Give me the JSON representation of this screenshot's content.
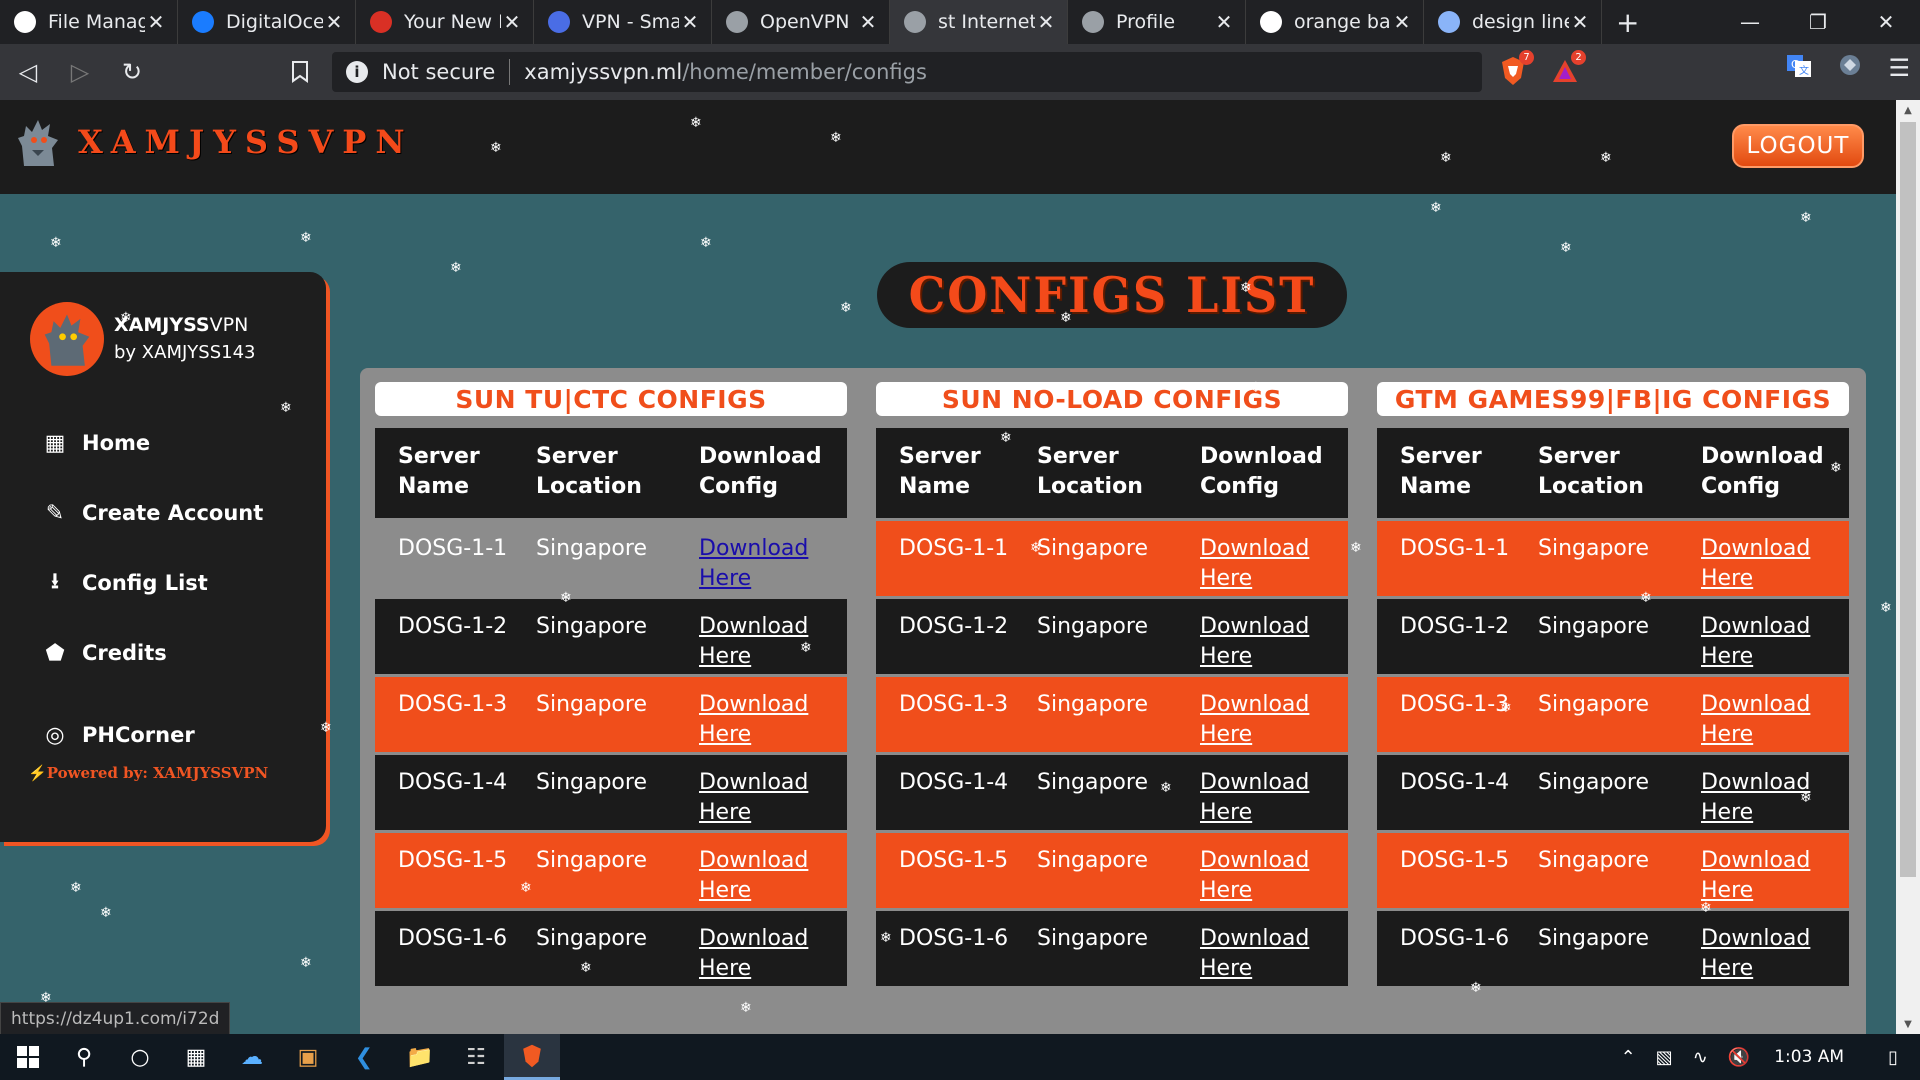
{
  "browser": {
    "tabs": [
      {
        "label": "File Manager",
        "icon": "cloud-icon",
        "color": "#ffffff",
        "active": false
      },
      {
        "label": "DigitalOcean",
        "icon": "digitalocean-icon",
        "color": "#1a7cff",
        "active": false
      },
      {
        "label": "Your New Domain",
        "icon": "gmail-icon",
        "color": "#d93025",
        "active": false
      },
      {
        "label": "VPN - Smart",
        "icon": "shield-icon",
        "color": "#4a6de5",
        "active": false
      },
      {
        "label": "OpenVPN",
        "icon": "globe-icon",
        "color": "#9aa0a6",
        "active": false
      },
      {
        "label": "st Internet Provider",
        "icon": "globe-icon",
        "color": "#9aa0a6",
        "active": true
      },
      {
        "label": "Profile",
        "icon": "globe-icon",
        "color": "#9aa0a6",
        "active": false
      },
      {
        "label": "orange bar",
        "icon": "google-icon",
        "color": "#ffffff",
        "active": false
      },
      {
        "label": "design line",
        "icon": "document-icon",
        "color": "#8ab4f8",
        "active": false
      }
    ],
    "new_tab": "+",
    "security_label": "Not secure",
    "url_host": "xamjyssvpn.ml",
    "url_path": "/home/member/configs",
    "brave_shield_count": "7",
    "brave_rewards_count": "2",
    "status_url": "https://dz4up1.com/i72d"
  },
  "site": {
    "brand": "XAMJYSSVPN",
    "logout_label": "LOGOUT",
    "page_title": "CONFIGS LIST",
    "accent": "#f04e1b"
  },
  "sidebar": {
    "profile_name_bold": "XAMJYSS",
    "profile_name_rest": "VPN",
    "profile_by": "by XAMJYSS143",
    "items": [
      {
        "label": "Home",
        "icon": "home-grid-icon"
      },
      {
        "label": "Create Account",
        "icon": "pencil-icon"
      },
      {
        "label": "Config List",
        "icon": "download-icon"
      },
      {
        "label": "Credits",
        "icon": "tags-icon"
      },
      {
        "label": "PHCorner",
        "icon": "globe-icon"
      }
    ],
    "powered": "Powered by: XAMJYSSVPN"
  },
  "tables": [
    {
      "title": "SUN TU|CTC CONFIGS",
      "headers": [
        "Server Name",
        "Server Location",
        "Download Config"
      ],
      "rows": [
        {
          "name": "DOSG-1-1",
          "location": "Singapore",
          "link": "Download Here"
        },
        {
          "name": "DOSG-1-2",
          "location": "Singapore",
          "link": "Download Here"
        },
        {
          "name": "DOSG-1-3",
          "location": "Singapore",
          "link": "Download Here"
        },
        {
          "name": "DOSG-1-4",
          "location": "Singapore",
          "link": "Download Here"
        },
        {
          "name": "DOSG-1-5",
          "location": "Singapore",
          "link": "Download Here"
        },
        {
          "name": "DOSG-1-6",
          "location": "Singapore",
          "link": "Download Here"
        }
      ]
    },
    {
      "title": "SUN NO-LOAD CONFIGS",
      "headers": [
        "Server Name",
        "Server Location",
        "Download Config"
      ],
      "rows": [
        {
          "name": "DOSG-1-1",
          "location": "Singapore",
          "link": "Download Here"
        },
        {
          "name": "DOSG-1-2",
          "location": "Singapore",
          "link": "Download Here"
        },
        {
          "name": "DOSG-1-3",
          "location": "Singapore",
          "link": "Download Here"
        },
        {
          "name": "DOSG-1-4",
          "location": "Singapore",
          "link": "Download Here"
        },
        {
          "name": "DOSG-1-5",
          "location": "Singapore",
          "link": "Download Here"
        },
        {
          "name": "DOSG-1-6",
          "location": "Singapore",
          "link": "Download Here"
        }
      ]
    },
    {
      "title": "GTM GAMES99|FB|IG CONFIGS",
      "headers": [
        "Server Name",
        "Server Location",
        "Download Config"
      ],
      "rows": [
        {
          "name": "DOSG-1-1",
          "location": "Singapore",
          "link": "Download Here"
        },
        {
          "name": "DOSG-1-2",
          "location": "Singapore",
          "link": "Download Here"
        },
        {
          "name": "DOSG-1-3",
          "location": "Singapore",
          "link": "Download Here"
        },
        {
          "name": "DOSG-1-4",
          "location": "Singapore",
          "link": "Download Here"
        },
        {
          "name": "DOSG-1-5",
          "location": "Singapore",
          "link": "Download Here"
        },
        {
          "name": "DOSG-1-6",
          "location": "Singapore",
          "link": "Download Here"
        }
      ]
    }
  ],
  "taskbar": {
    "time": "1:03 AM"
  }
}
